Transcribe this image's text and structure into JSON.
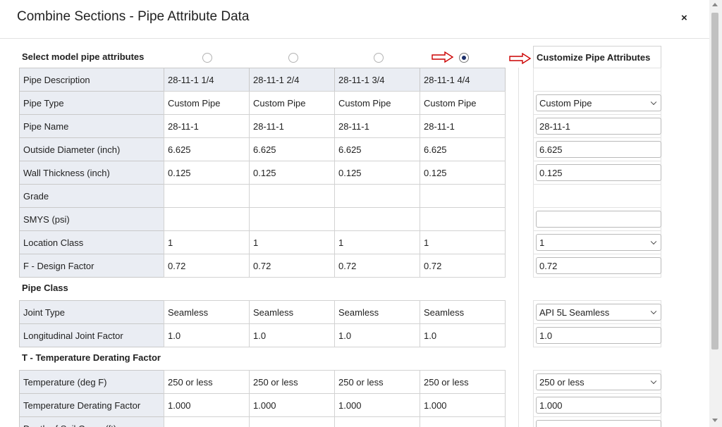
{
  "dialog": {
    "title": "Combine Sections - Pipe Attribute Data",
    "close_label": "×"
  },
  "header_row": {
    "label": "Select model pipe attributes",
    "customize_label": "Customize Pipe Attributes",
    "selected_index": 3
  },
  "columns": [
    "28-11-1 1/4",
    "28-11-1 2/4",
    "28-11-1 3/4",
    "28-11-1 4/4"
  ],
  "rows": [
    {
      "label": "Pipe Description",
      "values": [
        "28-11-1 1/4",
        "28-11-1 2/4",
        "28-11-1 3/4",
        "28-11-1 4/4"
      ],
      "custom": {
        "type": "none",
        "value": ""
      }
    },
    {
      "label": "Pipe Type",
      "values": [
        "Custom Pipe",
        "Custom Pipe",
        "Custom Pipe",
        "Custom Pipe"
      ],
      "custom": {
        "type": "select",
        "value": "Custom Pipe"
      }
    },
    {
      "label": "Pipe Name",
      "values": [
        "28-11-1",
        "28-11-1",
        "28-11-1",
        "28-11-1"
      ],
      "custom": {
        "type": "input",
        "value": "28-11-1"
      }
    },
    {
      "label": "Outside Diameter (inch)",
      "values": [
        "6.625",
        "6.625",
        "6.625",
        "6.625"
      ],
      "custom": {
        "type": "input",
        "value": "6.625"
      }
    },
    {
      "label": "Wall Thickness (inch)",
      "values": [
        "0.125",
        "0.125",
        "0.125",
        "0.125"
      ],
      "custom": {
        "type": "input",
        "value": "0.125"
      }
    },
    {
      "label": "Grade",
      "values": [
        "",
        "",
        "",
        ""
      ],
      "custom": {
        "type": "none",
        "value": ""
      }
    },
    {
      "label": "SMYS (psi)",
      "values": [
        "",
        "",
        "",
        ""
      ],
      "custom": {
        "type": "input",
        "value": ""
      }
    },
    {
      "label": "Location Class",
      "values": [
        "1",
        "1",
        "1",
        "1"
      ],
      "custom": {
        "type": "select",
        "value": "1"
      }
    },
    {
      "label": "F - Design Factor",
      "values": [
        "0.72",
        "0.72",
        "0.72",
        "0.72"
      ],
      "custom": {
        "type": "input",
        "value": "0.72"
      }
    },
    {
      "section": "Pipe Class"
    },
    {
      "label": "Joint Type",
      "values": [
        "Seamless",
        "Seamless",
        "Seamless",
        "Seamless"
      ],
      "custom": {
        "type": "select",
        "value": "API 5L Seamless"
      }
    },
    {
      "label": "Longitudinal Joint Factor",
      "values": [
        "1.0",
        "1.0",
        "1.0",
        "1.0"
      ],
      "custom": {
        "type": "input",
        "value": "1.0"
      }
    },
    {
      "section": "T - Temperature Derating Factor"
    },
    {
      "label": "Temperature (deg F)",
      "values": [
        "250 or less",
        "250 or less",
        "250 or less",
        "250 or less"
      ],
      "custom": {
        "type": "select",
        "value": "250 or less"
      }
    },
    {
      "label": "Temperature Derating Factor",
      "values": [
        "1.000",
        "1.000",
        "1.000",
        "1.000"
      ],
      "custom": {
        "type": "input",
        "value": "1.000"
      }
    },
    {
      "label": "Depth of Soil Cover (ft)",
      "values": [
        "",
        "",
        "",
        ""
      ],
      "custom": {
        "type": "input",
        "value": ""
      }
    }
  ],
  "colors": {
    "label_bg": "#eaedf3",
    "arrow": "#cc0000",
    "radio_selected": "#1b2f6b"
  },
  "icons": {
    "close": "close-icon",
    "arrow": "right-arrow-icon",
    "dropdown": "chevron-down-icon"
  }
}
